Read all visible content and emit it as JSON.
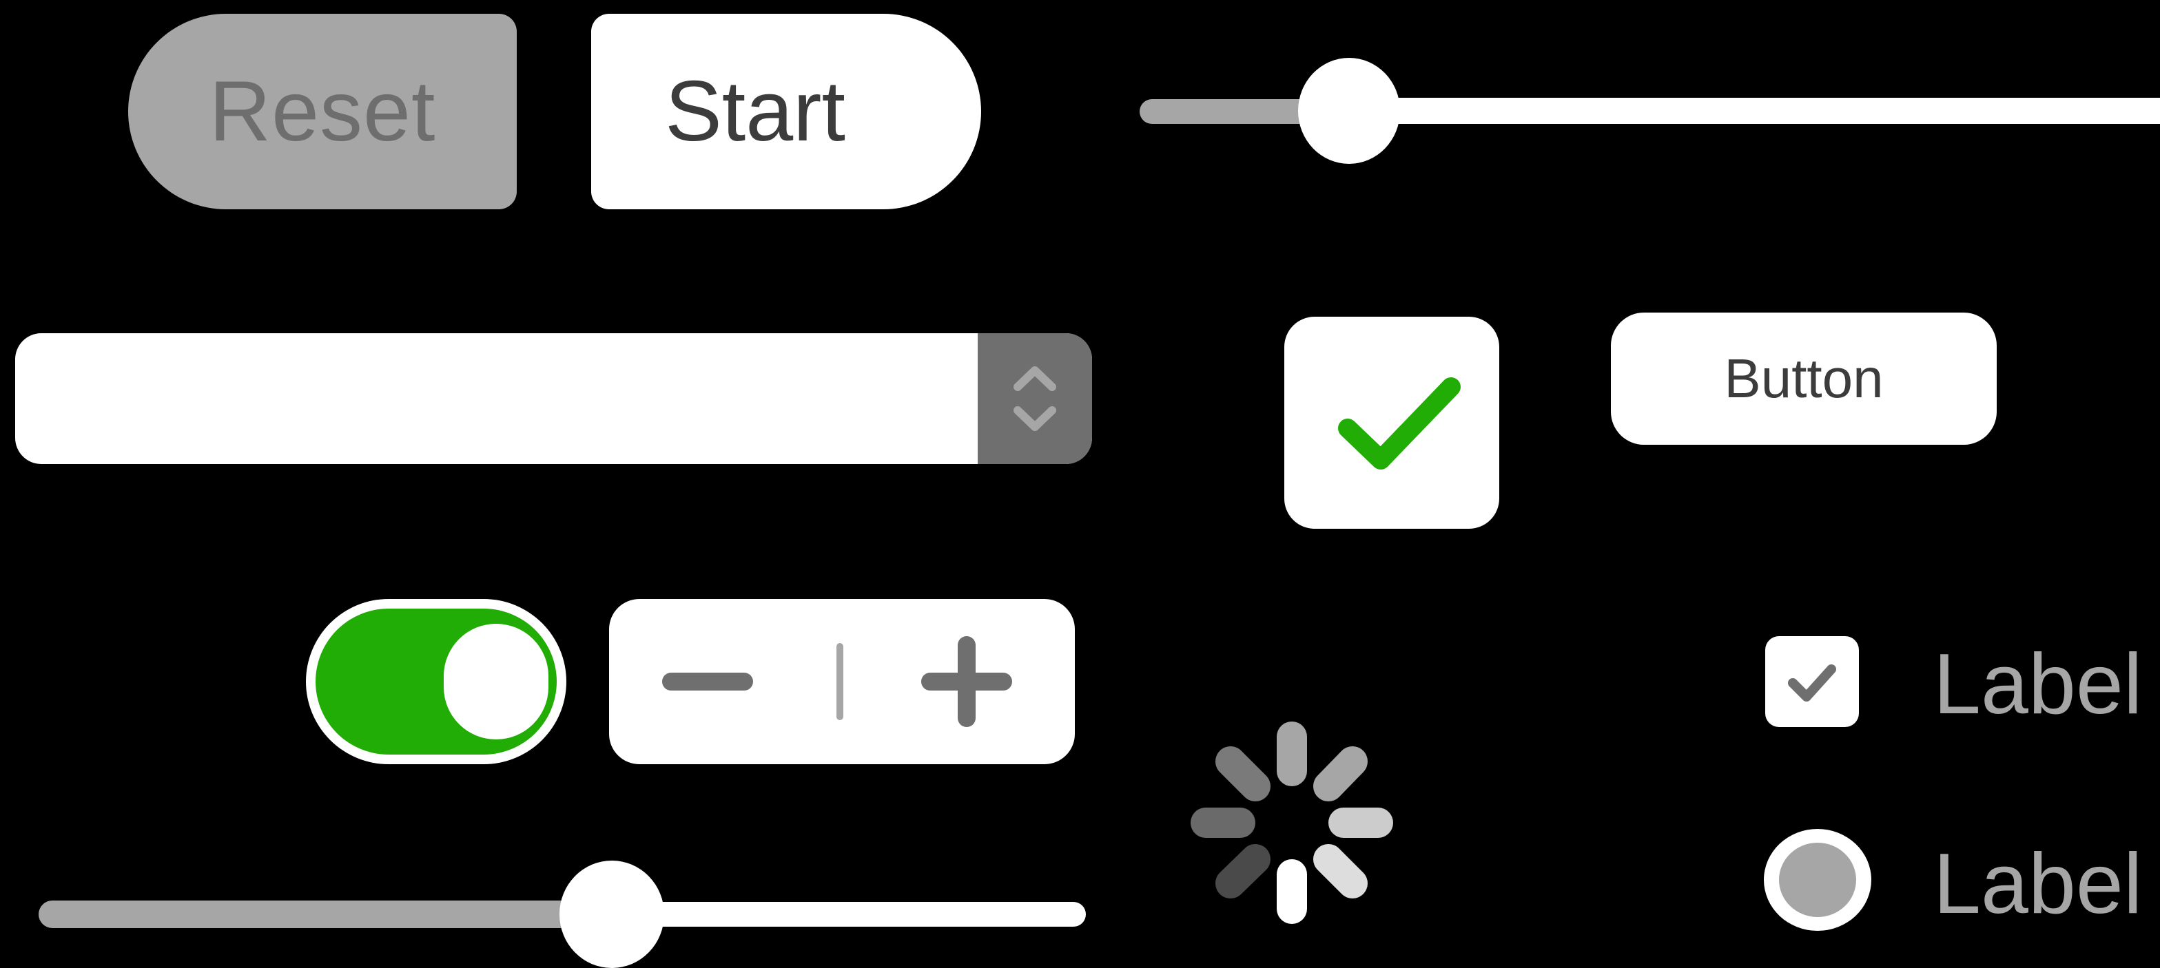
{
  "buttons": {
    "reset_label": "Reset",
    "start_label": "Start",
    "button_label": "Button"
  },
  "sliders": {
    "top": {
      "value_fraction": 0.07
    },
    "bottom": {
      "value_fraction": 0.54
    }
  },
  "toggle": {
    "state": "on"
  },
  "checkboxes": {
    "large": {
      "checked": true
    },
    "small": {
      "checked": true,
      "label": "Label"
    }
  },
  "radio": {
    "selected": true,
    "label": "Label"
  },
  "stepper": {
    "minus_symbol": "−",
    "plus_symbol": "+"
  },
  "colors": {
    "background": "#000000",
    "control_fill": "#ffffff",
    "disabled_fill": "#a6a6a6",
    "accent_green": "#22ad06",
    "dark_gray": "#6f6f6f",
    "text_dark": "#3c3c3c"
  },
  "icons": {
    "combo": "chevron-up-down-icon",
    "spinner": "activity-spinner-icon",
    "check": "checkmark-icon"
  }
}
